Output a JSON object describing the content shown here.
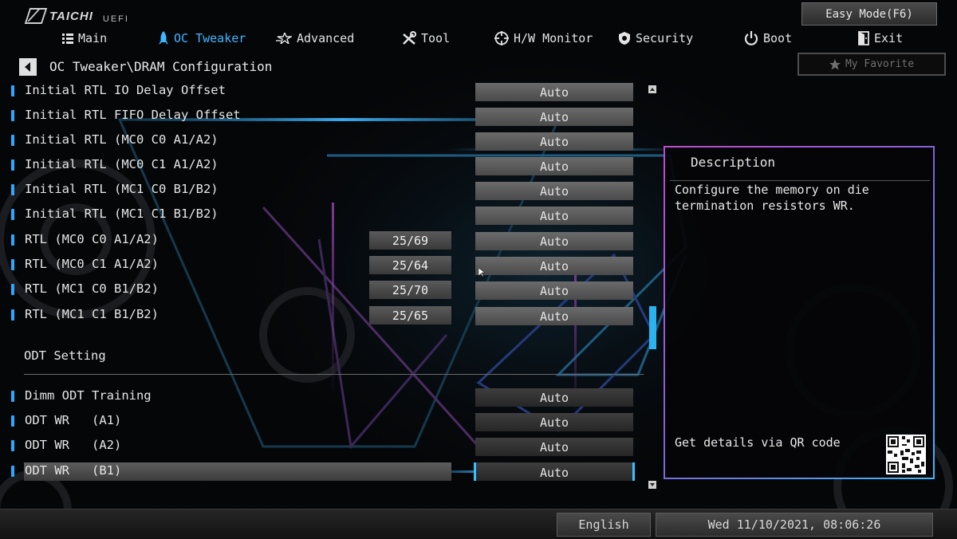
{
  "brand": {
    "logo": "TAICHI",
    "subtitle": "UEFI"
  },
  "header": {
    "easy_mode": "Easy Mode(F6)",
    "my_favorite": "My Favorite"
  },
  "nav": {
    "items": [
      {
        "label": "Main",
        "icon": "list-icon"
      },
      {
        "label": "OC Tweaker",
        "icon": "rocket-icon",
        "active": true
      },
      {
        "label": "Advanced",
        "icon": "star-icon"
      },
      {
        "label": "Tool",
        "icon": "tools-icon"
      },
      {
        "label": "H/W Monitor",
        "icon": "crosshair-icon"
      },
      {
        "label": "Security",
        "icon": "shield-icon"
      },
      {
        "label": "Boot",
        "icon": "power-icon"
      },
      {
        "label": "Exit",
        "icon": "exit-icon"
      }
    ]
  },
  "breadcrumb": "OC Tweaker\\DRAM Configuration",
  "rows": [
    {
      "label": "Initial RTL IO Delay Offset",
      "value": "Auto"
    },
    {
      "label": "Initial RTL FIFO Delay Offset",
      "value": "Auto"
    },
    {
      "label": "Initial RTL (MC0 C0 A1/A2)",
      "value": "Auto"
    },
    {
      "label": "Initial RTL (MC0 C1 A1/A2)",
      "value": "Auto"
    },
    {
      "label": "Initial RTL (MC1 C0 B1/B2)",
      "value": "Auto"
    },
    {
      "label": "Initial RTL (MC1 C1 B1/B2)",
      "value": "Auto"
    },
    {
      "label": "RTL (MC0 C0 A1/A2)",
      "current": "25/69",
      "value": "Auto"
    },
    {
      "label": "RTL (MC0 C1 A1/A2)",
      "current": "25/64",
      "value": "Auto"
    },
    {
      "label": "RTL (MC1 C0 B1/B2)",
      "current": "25/70",
      "value": "Auto"
    },
    {
      "label": "RTL (MC1 C1 B1/B2)",
      "current": "25/65",
      "value": "Auto"
    }
  ],
  "odt": {
    "section_title": "ODT Setting",
    "rows": [
      {
        "label": "Dimm ODT Training",
        "value": "Auto"
      },
      {
        "label": "ODT WR   (A1)",
        "value": "Auto"
      },
      {
        "label": "ODT WR   (A2)",
        "value": "Auto"
      },
      {
        "label": "ODT WR   (B1)",
        "value": "Auto",
        "selected": true
      }
    ]
  },
  "description": {
    "title": "Description",
    "text": "Configure the memory on die termination resistors WR.",
    "qr_text": "Get details via QR code"
  },
  "footer": {
    "language": "English",
    "datetime": "Wed 11/10/2021, 08:06:26"
  },
  "colors": {
    "accent": "#3fb7ff",
    "panel_border_start": "#c04ad0",
    "panel_border_end": "#3fb7ff"
  }
}
